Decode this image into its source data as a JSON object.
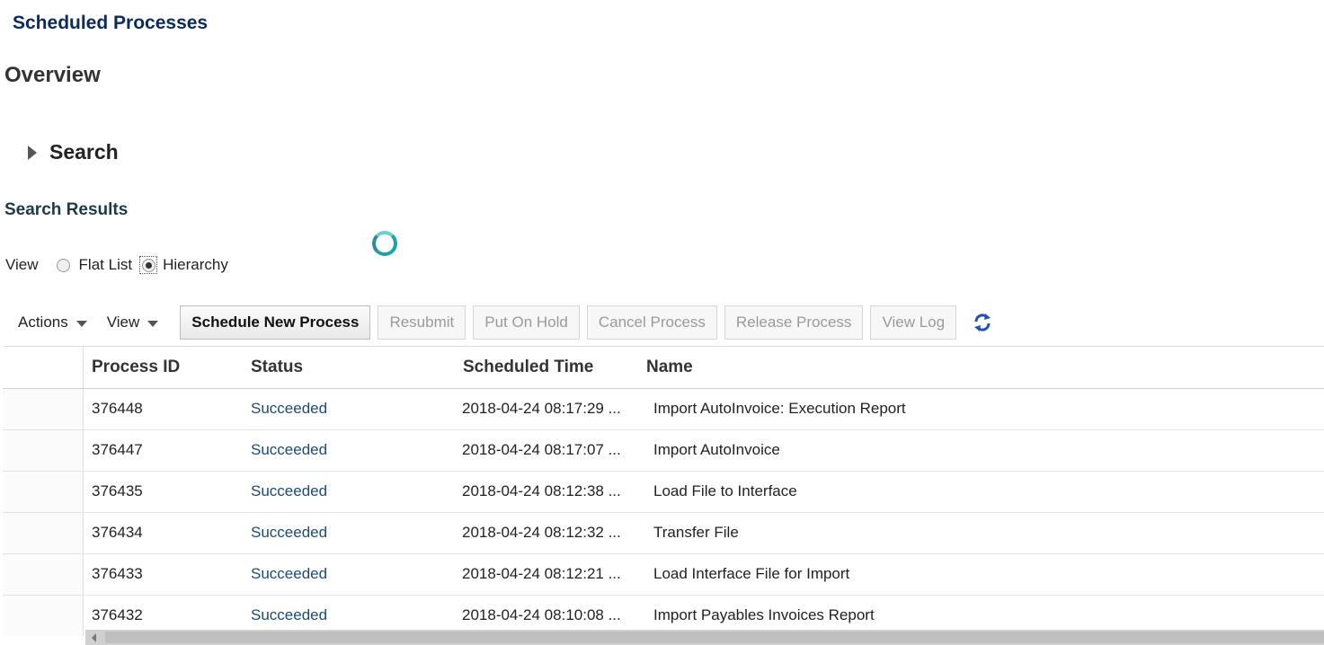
{
  "page": {
    "title": "Scheduled Processes",
    "section_title": "Overview"
  },
  "search": {
    "label": "Search"
  },
  "results": {
    "title": "Search Results",
    "view_label": "View",
    "view_options": [
      "Flat List",
      "Hierarchy"
    ],
    "selected_view": "Hierarchy"
  },
  "toolbar": {
    "actions_label": "Actions",
    "view_label": "View",
    "buttons": {
      "schedule": "Schedule New Process",
      "resubmit": "Resubmit",
      "hold": "Put On Hold",
      "cancel": "Cancel Process",
      "release": "Release Process",
      "log": "View Log"
    },
    "refresh_icon": "refresh-icon"
  },
  "table": {
    "columns": [
      "Process ID",
      "Status",
      "Scheduled Time",
      "Name"
    ],
    "rows": [
      {
        "id": "376448",
        "status": "Succeeded",
        "time": "2018-04-24 08:17:29 ...",
        "name": "Import AutoInvoice: Execution Report"
      },
      {
        "id": "376447",
        "status": "Succeeded",
        "time": "2018-04-24 08:17:07 ...",
        "name": "Import AutoInvoice"
      },
      {
        "id": "376435",
        "status": "Succeeded",
        "time": "2018-04-24 08:12:38 ...",
        "name": "Load File to Interface"
      },
      {
        "id": "376434",
        "status": "Succeeded",
        "time": "2018-04-24 08:12:32 ...",
        "name": "Transfer File"
      },
      {
        "id": "376433",
        "status": "Succeeded",
        "time": "2018-04-24 08:12:21 ...",
        "name": "Load Interface File for Import"
      },
      {
        "id": "376432",
        "status": "Succeeded",
        "time": "2018-04-24 08:10:08 ...",
        "name": "Import Payables Invoices Report"
      }
    ]
  },
  "colors": {
    "title": "#0c2a5b",
    "status_text": "#1c4a73",
    "spinner": "#1aa3a8",
    "refresh": "#1f4fb8"
  }
}
